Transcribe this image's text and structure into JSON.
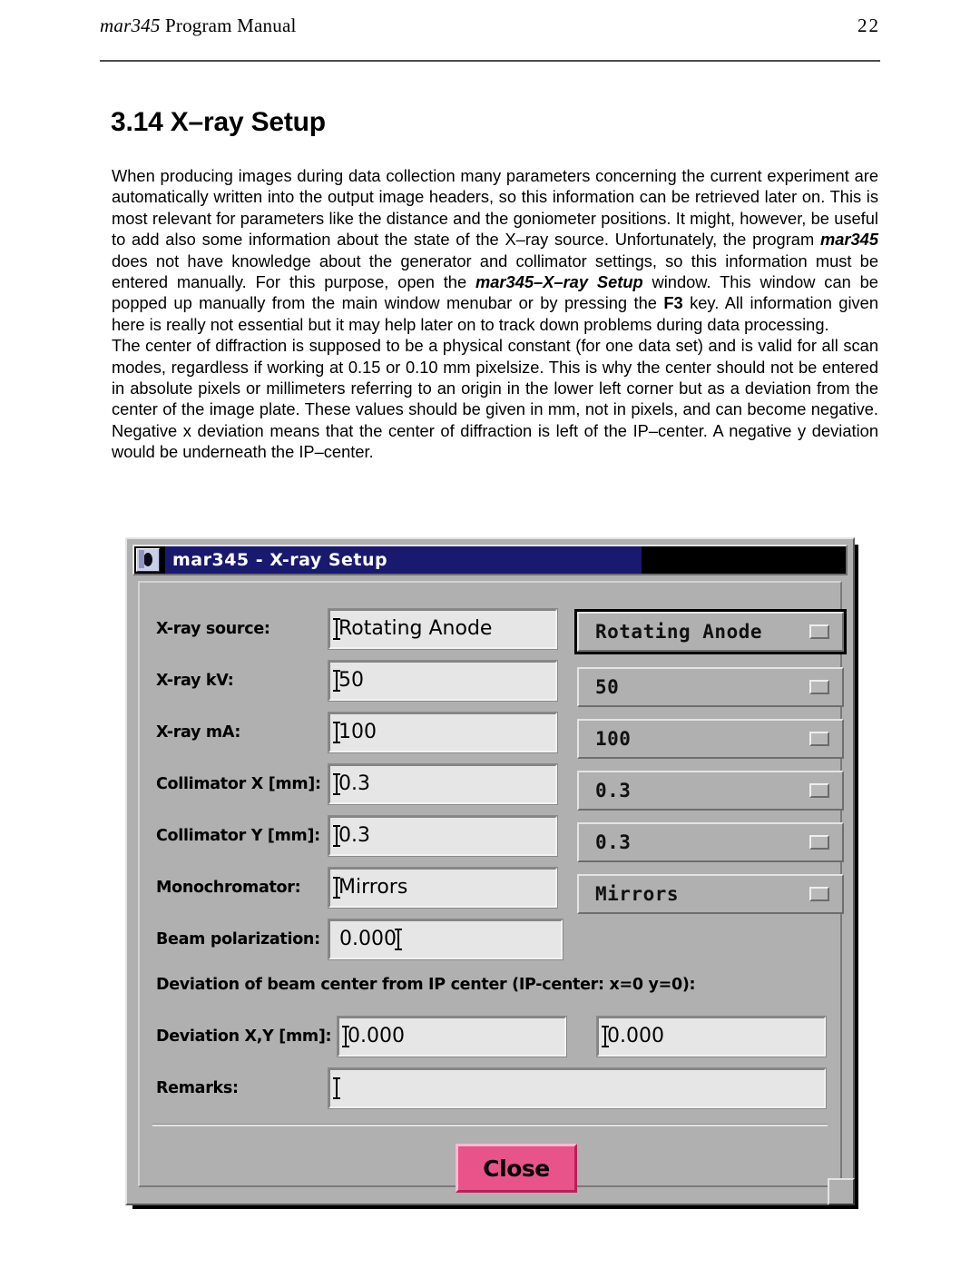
{
  "page": {
    "header_title_italic": "mar345",
    "header_title_rest": " Program Manual",
    "page_number": "22",
    "section_heading": "3.14 X–ray Setup",
    "paragraph_1_parts": [
      {
        "t": "When producing images during data collection many parameters concerning the current experiment are automatically written into the output image headers, so this information can be retrieved later on. This is most relevant for parameters like the distance and the goniometer positions. It might, however, be useful to add also some information about the state of the X–ray source. Unfortunately, the program ",
        "s": "n"
      },
      {
        "t": "mar345",
        "s": "bi"
      },
      {
        "t": " does not have knowledge about the generator and collimator settings, so this information must be entered manually. For this purpose, open the ",
        "s": "n"
      },
      {
        "t": "mar345–X–ray Setup",
        "s": "bi"
      },
      {
        "t": " window. This window can be popped up manually from the main window menubar or by pressing the ",
        "s": "n"
      },
      {
        "t": "F3",
        "s": "b"
      },
      {
        "t": " key. All information given here is really not essential but it may help later on to track down problems during data processing.",
        "s": "n"
      }
    ],
    "paragraph_2": "The center of diffraction is supposed to be a physical constant (for one data set) and is valid for all scan modes, regardless if working at 0.15 or 0.10 mm pixelsize. This is why the center should not be entered in absolute pixels or millimeters referring to an origin in the lower left corner but as a deviation from the center of the image plate. These values should be given in mm, not in pixels, and can become negative. Negative x deviation means that the center of diffraction is left of the IP–center. A negative y deviation would be underneath the IP–center."
  },
  "dialog": {
    "title": "mar345 - X-ray Setup",
    "icon": "mar345-app-icon",
    "colors": {
      "titlebar": "#191970",
      "face": "#b0b0b0",
      "field": "#e6e6e6",
      "close_button": "#e8548a"
    },
    "rows": [
      {
        "label": "X-ray source:",
        "value": "Rotating Anode",
        "menu": "Rotating Anode",
        "has_menu": true,
        "menu_focused": true
      },
      {
        "label": "X-ray  kV:",
        "value": "50",
        "menu": "50",
        "has_menu": true,
        "menu_focused": false
      },
      {
        "label": "X-ray  mA:",
        "value": "100",
        "menu": "100",
        "has_menu": true,
        "menu_focused": false
      },
      {
        "label": "Collimator X [mm]:",
        "value": "0.3",
        "menu": "0.3",
        "has_menu": true,
        "menu_focused": false
      },
      {
        "label": "Collimator Y [mm]:",
        "value": "0.3",
        "menu": "0.3",
        "has_menu": true,
        "menu_focused": false
      },
      {
        "label": "Monochromator:",
        "value": "Mirrors",
        "menu": "Mirrors",
        "has_menu": true,
        "menu_focused": false
      },
      {
        "label": "Beam polarization:",
        "value": "0.000",
        "menu": "",
        "has_menu": false,
        "menu_focused": false
      }
    ],
    "deviation_group_label": "Deviation of beam center from IP center (IP-center: x=0 y=0):",
    "deviation_row": {
      "label": "Deviation X,Y [mm]:",
      "value_x": "0.000",
      "value_y": "0.000"
    },
    "remarks_row": {
      "label": "Remarks:",
      "value": ""
    },
    "close_label": "Close"
  }
}
